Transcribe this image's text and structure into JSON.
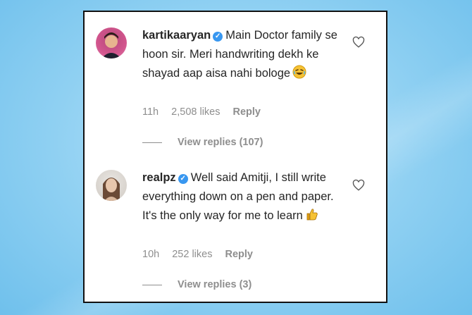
{
  "comments": [
    {
      "username": "kartikaaryan",
      "text": "Main Doctor family se hoon sir. Meri handwriting dekh ke shayad aap aisa nahi bologe",
      "emoji": "laughing-emoji",
      "time": "11h",
      "likes": "2,508 likes",
      "reply_label": "Reply",
      "view_replies": "View replies (107)"
    },
    {
      "username": "realpz",
      "text": "Well said Amitji, I still write everything down on a pen and paper. It's the only way for me to learn",
      "emoji": "thumbs-up-emoji",
      "time": "10h",
      "likes": "252 likes",
      "reply_label": "Reply",
      "view_replies": "View replies (3)"
    }
  ],
  "colors": {
    "verified": "#3897f0",
    "meta": "#8e8e8e",
    "text": "#262626"
  }
}
